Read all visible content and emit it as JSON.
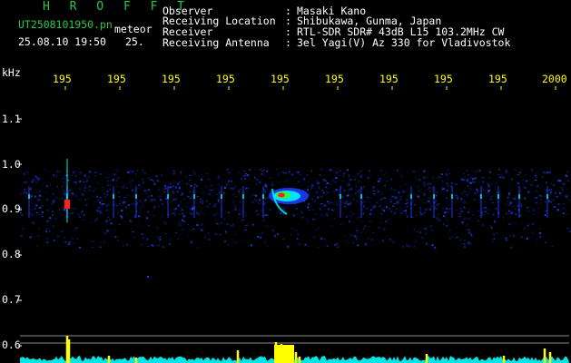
{
  "header": {
    "app_title": "H R O F F T",
    "file_name": "UT2508101950.pn",
    "mode": "meteor",
    "timestamp": "25.08.10 19:50",
    "extra": "25.",
    "fields": [
      {
        "label": "Observer",
        "sep": ":",
        "value": "Masaki Kano"
      },
      {
        "label": "Receiving Location",
        "sep": ":",
        "value": "Shibukawa, Gunma, Japan"
      },
      {
        "label": "Receiver",
        "sep": ":",
        "value": "RTL-SDR SDR# 43dB L15 103.2MHz CW"
      },
      {
        "label": "Receiving Antenna",
        "sep": ":",
        "value": "3el Yagi(V) Az 330 for Vladivostok"
      }
    ]
  },
  "axis": {
    "unit": "kHz",
    "x_ticks": [
      "195",
      "195",
      "195",
      "195",
      "195",
      "195",
      "195",
      "195",
      "195",
      "2000"
    ],
    "y_ticks": [
      "1.1",
      "1.0",
      "0.9",
      "0.8",
      "0.7",
      "0.6"
    ]
  },
  "colors": {
    "background": "#000000",
    "label_green": "#27c84a",
    "text_white": "#ffffff",
    "tick_yellow": "#ffff00",
    "noise_blue": "#1a3cff",
    "signal_cyan": "#00ffff",
    "signal_red": "#ff2020",
    "trace_yellow": "#ffff00"
  }
}
